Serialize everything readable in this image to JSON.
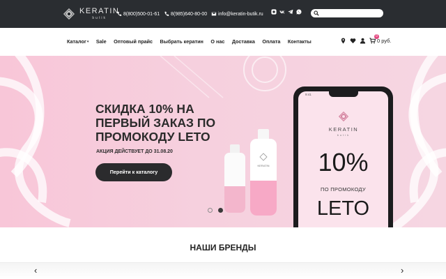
{
  "header": {
    "logo_word": "KERATIN",
    "logo_sub": "butik",
    "phone1": "8(800)500-01-61",
    "phone2": "8(985)640-80-00",
    "email": "info@keratin-butik.ru",
    "socials": [
      "instagram-icon",
      "vk-icon",
      "telegram-icon",
      "whatsapp-icon"
    ],
    "search_placeholder": ""
  },
  "nav": {
    "items": [
      "Каталог",
      "Sale",
      "Оптовый прайс",
      "Выбрать кератин",
      "О нас",
      "Доставка",
      "Оплата",
      "Контакты"
    ],
    "cart_count": "0",
    "cart_total": "0 руб."
  },
  "hero": {
    "title": "СКИДКА 10% НА ПЕРВЫЙ ЗАКАЗ ПО ПРОМОКОДУ LETO",
    "note": "АКЦИЯ ДЕЙСТВУЕТ ДО 31.08.20",
    "button": "Перейти к каталогу",
    "slides": 3,
    "active_slide": 2,
    "phone": {
      "time": "9:41",
      "logo_word": "KERATIN",
      "logo_sub": "butik",
      "percent": "10%",
      "promo_label": "ПО ПРОМОКОДУ",
      "code": "LETO"
    },
    "bottle_label": "KERATIN"
  },
  "brands": {
    "title": "НАШИ БРЕНДЫ",
    "prev": "‹",
    "next": "›"
  },
  "colors": {
    "topbar": "#2a2d31",
    "accent": "#e2467f",
    "hero_bg": "#f6d0de",
    "button": "#2b2b2d"
  }
}
